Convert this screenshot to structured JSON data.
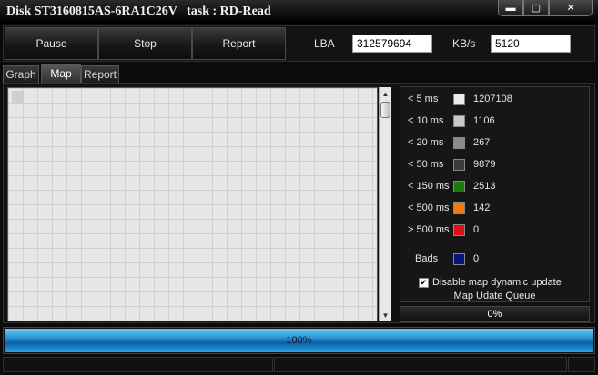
{
  "window": {
    "title": "Disk ST3160815AS-6RA1C26V   task : RD-Read",
    "minimize_icon": "minimize-icon",
    "maximize_icon": "maximize-icon",
    "close_icon": "close-icon"
  },
  "toolbar": {
    "pause_label": "Pause",
    "stop_label": "Stop",
    "report_label": "Report",
    "lba_label": "LBA",
    "lba_value": "312579694",
    "kbs_label": "KB/s",
    "kbs_value": "5120"
  },
  "tabs": [
    {
      "label": "Graph",
      "active": false
    },
    {
      "label": "Map",
      "active": true
    },
    {
      "label": "Report",
      "active": false
    }
  ],
  "legend": {
    "rows": [
      {
        "label": "< 5 ms",
        "color": "#eeeeee",
        "count": "1207108"
      },
      {
        "label": "< 10 ms",
        "color": "#c8c8c8",
        "count": "1106"
      },
      {
        "label": "< 20 ms",
        "color": "#8a8a8a",
        "count": "267"
      },
      {
        "label": "< 50 ms",
        "color": "#3c3c3c",
        "count": "9879"
      },
      {
        "label": "< 150 ms",
        "color": "#1a7a10",
        "count": "2513"
      },
      {
        "label": "< 500 ms",
        "color": "#f07c10",
        "count": "142"
      },
      {
        "label": "> 500 ms",
        "color": "#e01010",
        "count": "0"
      }
    ],
    "bads": {
      "label": "Bads",
      "color": "#0a1480",
      "count": "0"
    },
    "disable_update_label": "Disable map dynamic update",
    "disable_update_checked": true,
    "queue_label": "Map Udate Queue",
    "queue_value": "0%",
    "queue_level": 0
  },
  "progress": {
    "text": "100%",
    "level": 1.0
  }
}
